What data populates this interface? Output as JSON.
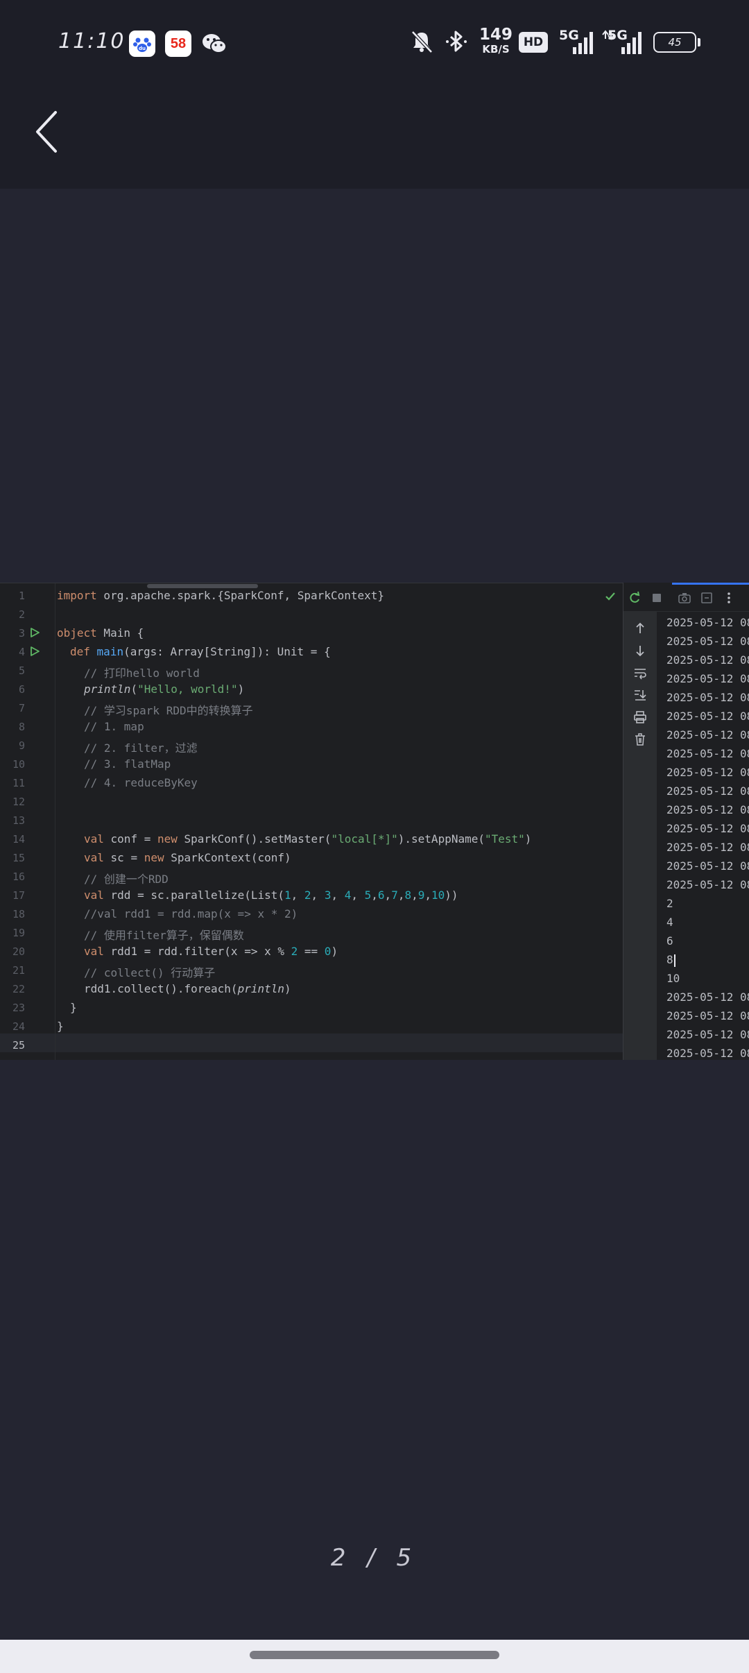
{
  "status_bar": {
    "time": "11:10",
    "network_speed": "149",
    "network_speed_unit": "KB/S",
    "hd_label": "HD",
    "signal_1_label": "5G",
    "signal_2_label": "5G",
    "battery_level": "45"
  },
  "apps": {
    "app_58_label": "58"
  },
  "ide": {
    "line_numbers": [
      "1",
      "2",
      "3",
      "4",
      "5",
      "6",
      "7",
      "8",
      "9",
      "10",
      "11",
      "12",
      "13",
      "14",
      "15",
      "16",
      "17",
      "18",
      "19",
      "20",
      "21",
      "22",
      "23",
      "24",
      "25"
    ],
    "current_line": 25,
    "code": {
      "l1_kw": "import",
      "l1_rest": " org.apache.spark.{SparkConf, SparkContext}",
      "l3_kw": "object",
      "l3_rest": " Main {",
      "l4_kw": "def",
      "l4_fn": "main",
      "l4_rest": "(args: Array[String]): Unit = {",
      "l5": "// 打印hello world",
      "l6_fn": "println",
      "l6_open": "(",
      "l6_str": "\"Hello, world!\"",
      "l6_close": ")",
      "l7": "// 学习spark RDD中的转换算子",
      "l8": "// 1. map",
      "l9": "// 2. filter，过滤",
      "l10": "// 3. flatMap",
      "l11": "// 4. reduceByKey",
      "l14_kw1": "val",
      "l14_a": " conf = ",
      "l14_kw2": "new",
      "l14_b": " SparkConf().setMaster(",
      "l14_str1": "\"local[*]\"",
      "l14_c": ").setAppName(",
      "l14_str2": "\"Test\"",
      "l14_d": ")",
      "l15_kw1": "val",
      "l15_a": " sc = ",
      "l15_kw2": "new",
      "l15_b": " SparkContext(conf)",
      "l16": "// 创建一个RDD",
      "l17_kw": "val",
      "l17_a": " rdd = sc.parallelize(List(",
      "l17_n1": "1",
      "l17_n2": "2",
      "l17_n3": "3",
      "l17_n4": "4",
      "l17_n5": "5",
      "l17_n6": "6",
      "l17_n7": "7",
      "l17_n8": "8",
      "l17_n9": "9",
      "l17_n10": "10",
      "l17_end": "))",
      "l18": "//val rdd1 = rdd.map(x => x * 2)",
      "l19": "// 使用filter算子，保留偶数",
      "l20_kw": "val",
      "l20_a": " rdd1 = rdd.filter(x => x % ",
      "l20_n1": "2",
      "l20_b": " == ",
      "l20_n2": "0",
      "l20_c": ")",
      "l21": "// collect() 行动算子",
      "l22_a": "rdd1.collect().foreach(",
      "l22_fn": "println",
      "l22_b": ")",
      "l23": "}",
      "l24": "}"
    },
    "console_lines": [
      "2025-05-12 08",
      "2025-05-12 08",
      "2025-05-12 08",
      "2025-05-12 08",
      "2025-05-12 08",
      "2025-05-12 08",
      "2025-05-12 08",
      "2025-05-12 08",
      "2025-05-12 08",
      "2025-05-12 08",
      "2025-05-12 08",
      "2025-05-12 08",
      "2025-05-12 08",
      "2025-05-12 08",
      "2025-05-12 08",
      "2",
      "4",
      "6",
      "8",
      "10",
      "2025-05-12 08",
      "2025-05-12 08",
      "2025-05-12 08",
      "2025-05-12 08"
    ]
  },
  "pager": {
    "current": "2",
    "separator": "/",
    "total": "5"
  },
  "colors": {
    "background": "#242531",
    "top_area": "#1d1e27",
    "editor_bg": "#1e1f22",
    "keyword": "#cf8e6d",
    "function": "#56a8f5",
    "string": "#6aab73",
    "number": "#2aacb8",
    "comment": "#7a7e85",
    "run_green": "#5fb865",
    "accent_blue": "#3574f0"
  },
  "icons": [
    "back-icon",
    "baidu-app-icon",
    "app-58-icon",
    "wechat-icon",
    "mute-icon",
    "bluetooth-icon",
    "run-gutter-icon",
    "check-icon",
    "rerun-icon",
    "stop-icon",
    "camera-icon",
    "exit-icon",
    "more-icon",
    "up-arrow-icon",
    "down-arrow-icon",
    "soft-wrap-icon",
    "scroll-end-icon",
    "print-icon",
    "trash-icon"
  ]
}
